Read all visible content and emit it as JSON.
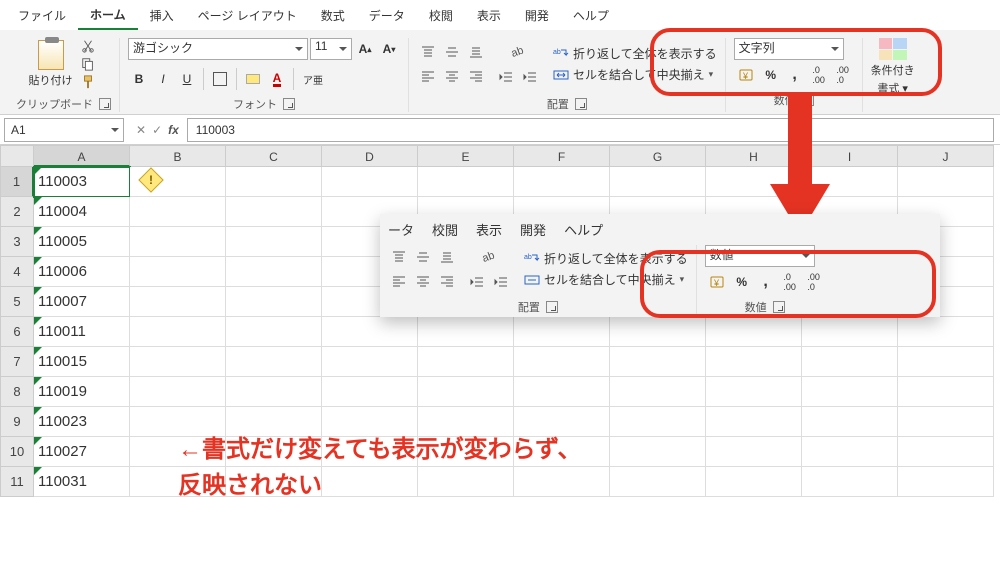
{
  "menu": {
    "file": "ファイル",
    "home": "ホーム",
    "insert": "挿入",
    "pagelayout": "ページ レイアウト",
    "formulas": "数式",
    "data": "データ",
    "review": "校閲",
    "view": "表示",
    "developer": "開発",
    "help": "ヘルプ"
  },
  "ribbon": {
    "clipboard": {
      "paste": "貼り付け",
      "label": "クリップボード"
    },
    "font": {
      "name": "游ゴシック",
      "size": "11",
      "bold": "B",
      "italic": "I",
      "underline": "U",
      "label": "フォント",
      "ruby": "ア亜",
      "increase": "A^",
      "decrease": "A˅",
      "colorA": "A"
    },
    "align": {
      "wrap": "折り返して全体を表示する",
      "merge": "セルを結合して中央揃え",
      "label": "配置"
    },
    "number": {
      "format1": "文字列",
      "format2": "数値",
      "label": "数値",
      "currency": "¥",
      "percent": "%",
      "comma": ",",
      "inc": ".00→.0",
      "dec": ".0→.00"
    },
    "cond": {
      "label1": "条件付き",
      "label2": "書式 ▾"
    }
  },
  "namebox": "A1",
  "formula": "110003",
  "cols": [
    "A",
    "B",
    "C",
    "D",
    "E",
    "F",
    "G",
    "H",
    "I",
    "J"
  ],
  "rows": [
    {
      "n": "1",
      "v": "110003"
    },
    {
      "n": "2",
      "v": "110004"
    },
    {
      "n": "3",
      "v": "110005"
    },
    {
      "n": "4",
      "v": "110006"
    },
    {
      "n": "5",
      "v": "110007"
    },
    {
      "n": "6",
      "v": "110011"
    },
    {
      "n": "7",
      "v": "110015"
    },
    {
      "n": "8",
      "v": "110019"
    },
    {
      "n": "9",
      "v": "110023"
    },
    {
      "n": "10",
      "v": "110027"
    },
    {
      "n": "11",
      "v": "110031"
    }
  ],
  "ribbon2_tabs": {
    "data": "ータ",
    "review": "校閲",
    "view": "表示",
    "developer": "開発",
    "help": "ヘルプ"
  },
  "annotation": "←書式だけ変えても表示が変わらず、\n反映されない"
}
